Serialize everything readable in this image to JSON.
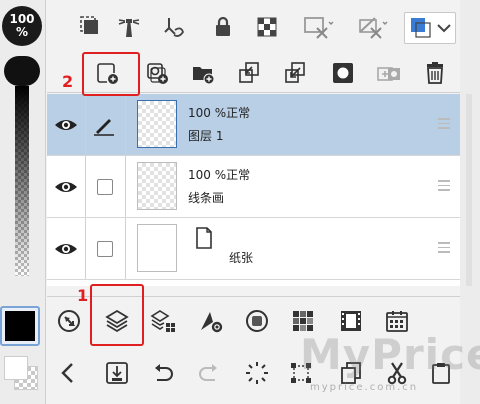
{
  "opacity": {
    "value": "100",
    "unit": "%"
  },
  "colors": {
    "main": "#000000",
    "sub": "#ffffff",
    "accent": "#3a7bd5",
    "selected_row": "#b9cfe6",
    "annotation": "#e02020"
  },
  "top_toolbar": {
    "icons": [
      "select-layer-icon",
      "lighthouse-icon",
      "stamp-icon",
      "lock-icon",
      "lock-transparent-icon",
      "clipping-icon",
      "reference-icon",
      "layer-color-icon"
    ]
  },
  "layer_toolbar": {
    "icons": [
      "new-raster-layer-icon",
      "new-vector-layer-icon",
      "new-folder-icon",
      "transfer-down-icon",
      "merge-down-icon",
      "mask-icon",
      "apply-mask-icon",
      "delete-icon"
    ]
  },
  "layers": [
    {
      "blend": "100 %正常",
      "name": "图层 1",
      "selected": true
    },
    {
      "blend": "100 %正常",
      "name": "线条画",
      "selected": false
    },
    {
      "blend": "",
      "name": "纸张",
      "selected": false
    }
  ],
  "palette_bar": {
    "icons": [
      "navigator-icon",
      "layers-icon",
      "layer-property-icon",
      "tool-property-icon",
      "color-circle-icon",
      "color-set-icon",
      "animation-icon",
      "material-icon"
    ]
  },
  "bottom_bar": {
    "icons": [
      "back-icon",
      "save-icon",
      "undo-icon",
      "redo-icon",
      "loading-icon",
      "transform-icon",
      "copy-icon",
      "cut-icon",
      "paste-icon"
    ]
  },
  "annotations": {
    "one": "1",
    "two": "2"
  },
  "watermark": {
    "big": "MyPrice",
    "small": "myprice.com.cn"
  }
}
